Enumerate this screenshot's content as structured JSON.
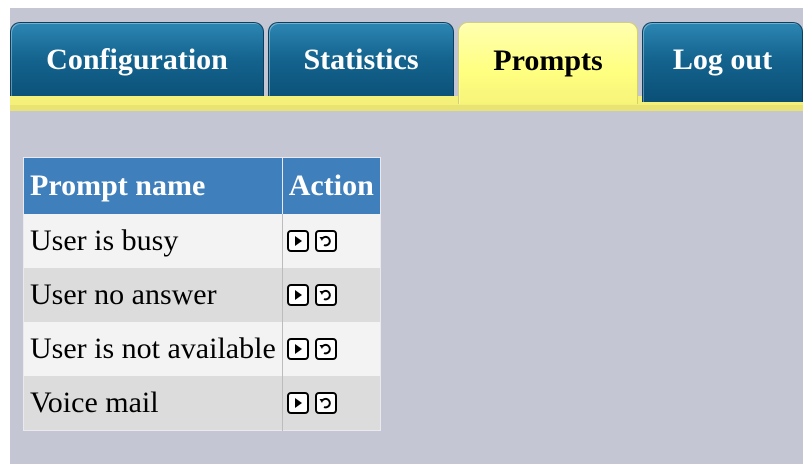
{
  "tabs": [
    {
      "label": "Configuration",
      "active": false
    },
    {
      "label": "Statistics",
      "active": false
    },
    {
      "label": "Prompts",
      "active": true
    },
    {
      "label": "Log out",
      "active": false
    }
  ],
  "table": {
    "headers": [
      "Prompt name",
      "Action"
    ],
    "rows": [
      {
        "name": "User is busy",
        "actions": [
          "play-icon",
          "reset-icon"
        ]
      },
      {
        "name": "User no answer",
        "actions": [
          "play-icon",
          "reset-icon"
        ]
      },
      {
        "name": "User is not available",
        "actions": [
          "play-icon",
          "reset-icon"
        ]
      },
      {
        "name": "Voice mail",
        "actions": [
          "play-icon",
          "reset-icon"
        ]
      }
    ]
  },
  "colors": {
    "tab_blue": "#14648f",
    "tab_active": "#ffff80",
    "header_blue": "#3f7fbb",
    "background": "#c4c7d3"
  }
}
